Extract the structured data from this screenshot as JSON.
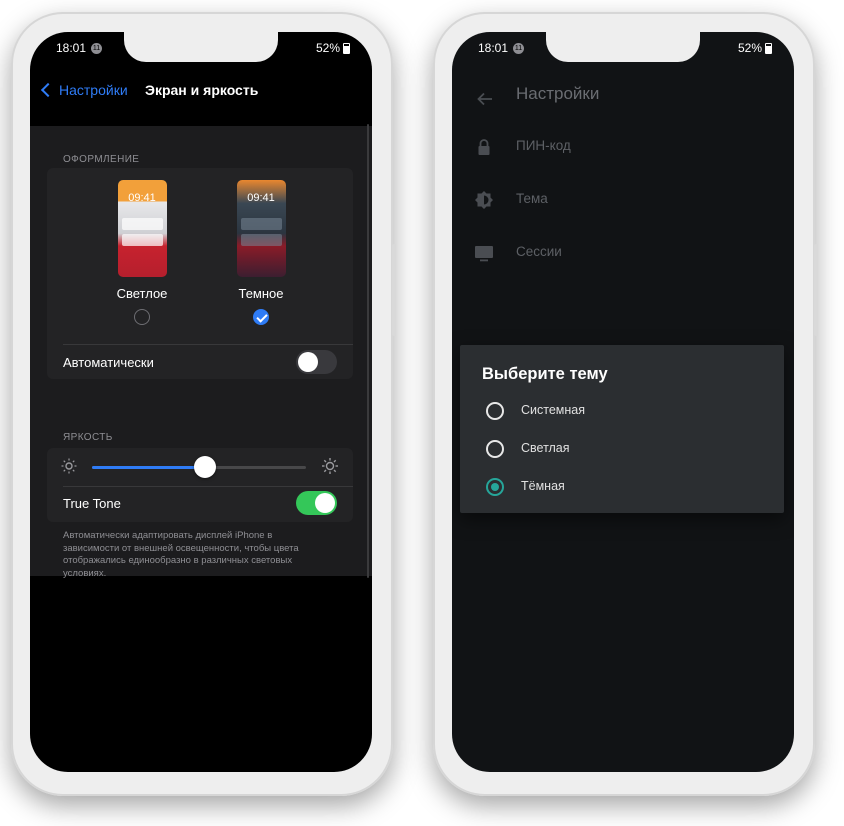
{
  "left_phone": {
    "status": {
      "time": "18:01",
      "badge": "11",
      "battery": "52%"
    },
    "nav": {
      "back_label": "Настройки",
      "title": "Экран и яркость"
    },
    "appearance": {
      "header": "ОФОРМЛЕНИЕ",
      "options": [
        {
          "label": "Светлое",
          "preview_time": "09:41",
          "selected": false
        },
        {
          "label": "Темное",
          "preview_time": "09:41",
          "selected": true
        }
      ],
      "auto_label": "Автоматически",
      "auto_on": false
    },
    "brightness": {
      "header": "ЯРКОСТЬ",
      "level": 0.53,
      "true_tone_label": "True Tone",
      "true_tone_on": true,
      "footnote": "Автоматически адаптировать дисплей iPhone в зависимости от внешней освещенности, чтобы цвета отображались единообразно в различных световых условиях."
    },
    "colors": {
      "accent": "#2f7cf6",
      "toggle_on": "#34c759"
    }
  },
  "right_phone": {
    "status": {
      "time": "18:01",
      "badge": "11",
      "battery": "52%"
    },
    "top_title": "Настройки",
    "menu": [
      {
        "label": "ПИН-код",
        "icon": "lock-icon"
      },
      {
        "label": "Тема",
        "icon": "theme-icon"
      },
      {
        "label": "Сессии",
        "icon": "monitor-icon"
      }
    ],
    "dialog": {
      "title": "Выберите тему",
      "options": [
        "Системная",
        "Светлая",
        "Тёмная"
      ],
      "selected_index": 2
    },
    "colors": {
      "accent": "#26a69a"
    }
  }
}
